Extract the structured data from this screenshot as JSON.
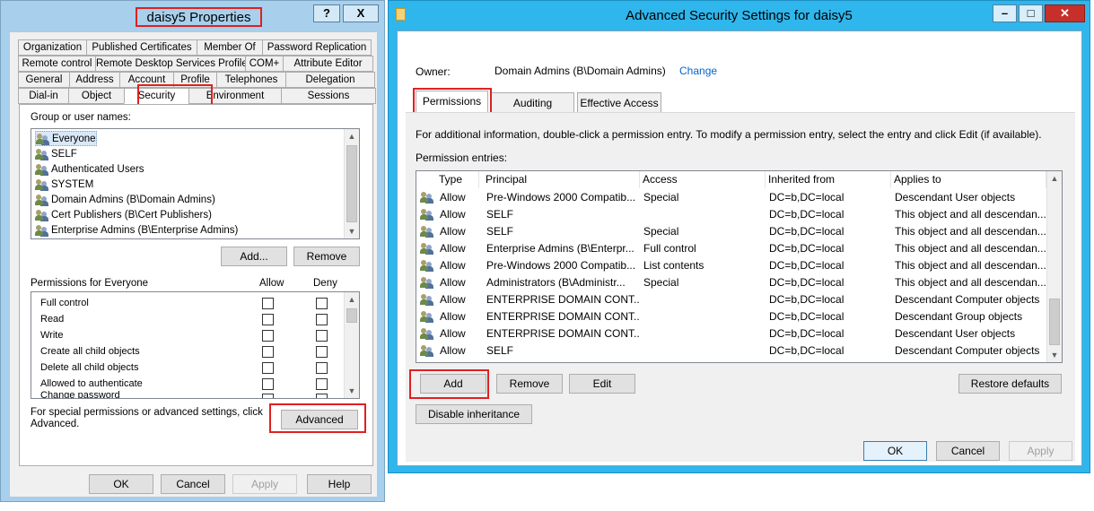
{
  "left_dialog": {
    "title": "daisy5 Properties",
    "help_label": "?",
    "close_label": "X",
    "tabs_row1": [
      "Organization",
      "Published Certificates",
      "Member Of",
      "Password Replication"
    ],
    "tabs_row2": [
      "Remote control",
      "Remote Desktop Services Profile",
      "COM+",
      "Attribute Editor"
    ],
    "tabs_row3": [
      "General",
      "Address",
      "Account",
      "Profile",
      "Telephones",
      "Delegation"
    ],
    "tabs_row4": [
      "Dial-in",
      "Object",
      "Security",
      "Environment",
      "Sessions"
    ],
    "group_label": "Group or user names:",
    "groups": [
      "Everyone",
      "SELF",
      "Authenticated Users",
      "SYSTEM",
      "Domain Admins (B\\Domain Admins)",
      "Cert Publishers (B\\Cert Publishers)",
      "Enterprise Admins (B\\Enterprise Admins)"
    ],
    "add_label": "Add...",
    "remove_label": "Remove",
    "permissions_label": "Permissions for Everyone",
    "allow_label": "Allow",
    "deny_label": "Deny",
    "permissions": [
      "Full control",
      "Read",
      "Write",
      "Create all child objects",
      "Delete all child objects",
      "Allowed to authenticate",
      "Change password"
    ],
    "special_text_line1": "For special permissions or advanced settings, click",
    "special_text_line2": "Advanced.",
    "advanced_label": "Advanced",
    "ok_label": "OK",
    "cancel_label": "Cancel",
    "apply_label": "Apply",
    "help_button_label": "Help"
  },
  "right_dialog": {
    "title": "Advanced Security Settings for daisy5",
    "owner_label": "Owner:",
    "owner_value": "Domain Admins (B\\Domain Admins)",
    "change_label": "Change",
    "tabs": [
      "Permissions",
      "Auditing",
      "Effective Access"
    ],
    "info_text": "For additional information, double-click a permission entry. To modify a permission entry, select the entry and click Edit (if available).",
    "entries_label": "Permission entries:",
    "columns": [
      "Type",
      "Principal",
      "Access",
      "Inherited from",
      "Applies to"
    ],
    "rows": [
      [
        "Allow",
        "Pre-Windows 2000 Compatib...",
        "Special",
        "DC=b,DC=local",
        "Descendant User objects"
      ],
      [
        "Allow",
        "SELF",
        "",
        "DC=b,DC=local",
        "This object and all descendan..."
      ],
      [
        "Allow",
        "SELF",
        "Special",
        "DC=b,DC=local",
        "This object and all descendan..."
      ],
      [
        "Allow",
        "Enterprise Admins (B\\Enterpr...",
        "Full control",
        "DC=b,DC=local",
        "This object and all descendan..."
      ],
      [
        "Allow",
        "Pre-Windows 2000 Compatib...",
        "List contents",
        "DC=b,DC=local",
        "This object and all descendan..."
      ],
      [
        "Allow",
        "Administrators (B\\Administr...",
        "Special",
        "DC=b,DC=local",
        "This object and all descendan..."
      ],
      [
        "Allow",
        "ENTERPRISE DOMAIN CONT...",
        "",
        "DC=b,DC=local",
        "Descendant Computer objects"
      ],
      [
        "Allow",
        "ENTERPRISE DOMAIN CONT...",
        "",
        "DC=b,DC=local",
        "Descendant Group objects"
      ],
      [
        "Allow",
        "ENTERPRISE DOMAIN CONT...",
        "",
        "DC=b,DC=local",
        "Descendant User objects"
      ],
      [
        "Allow",
        "SELF",
        "",
        "DC=b,DC=local",
        "Descendant Computer objects"
      ]
    ],
    "add_label": "Add",
    "remove_label": "Remove",
    "edit_label": "Edit",
    "restore_label": "Restore defaults",
    "disable_inheritance_label": "Disable inheritance",
    "ok_label": "OK",
    "cancel_label": "Cancel",
    "apply_label": "Apply"
  }
}
